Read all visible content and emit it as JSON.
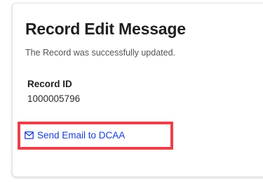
{
  "card": {
    "title": "Record Edit Message",
    "message": "The Record was successfully updated."
  },
  "record": {
    "label": "Record ID",
    "value": "1000005796"
  },
  "actions": {
    "send_email_label": "Send Email to DCAA",
    "send_email_icon": "mail-icon"
  },
  "colors": {
    "link": "#1a3fd0",
    "highlight": "#e8414b"
  }
}
